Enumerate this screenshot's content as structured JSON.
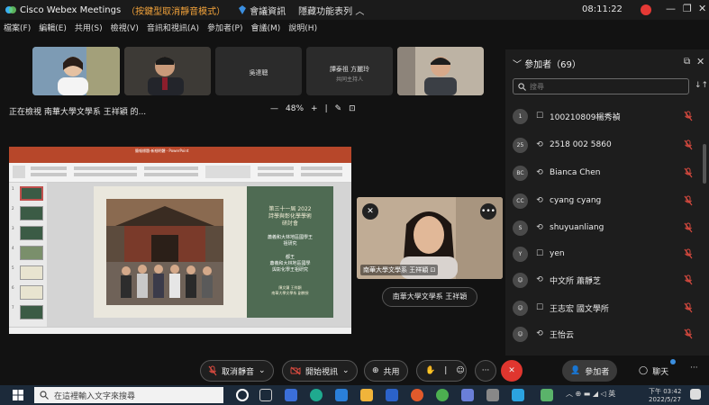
{
  "titlebar": {
    "app": "Cisco Webex Meetings",
    "mode": "（按鍵型取消靜音模式）",
    "meeting_info": "會議資訊",
    "hide_bar": "隱藏功能表列 ︿",
    "clock": "08:11:22"
  },
  "menu": [
    "檔案(F)",
    "編輯(E)",
    "共用(S)",
    "檢視(V)",
    "音訊和視訊(A)",
    "參加者(P)",
    "會議(M)",
    "說明(H)"
  ],
  "thumbnails": [
    {
      "name": ""
    },
    {
      "name": ""
    },
    {
      "name": "吳達聰"
    },
    {
      "name": "譚泰祖 方麗玲",
      "sub": "共同主持人"
    },
    {
      "name": ""
    }
  ],
  "share": {
    "status": "正在檢視 南華大學文學系 王祥穎 的...",
    "zoom": "48%"
  },
  "slide": {
    "panel_lines": [
      "第三十一屆 2022",
      "詩學與彰化學學術",
      "研討會",
      "蕭義和大林地區國學王",
      "祖研究",
      "都王",
      "蕭義和大林地區國學",
      "與彰化學王祖研究",
      "陳文蘭 王祥穎",
      "南華大學文學系 副教授"
    ],
    "title": "簡報標題-新細明體 - PowerPoint"
  },
  "speaker": {
    "label": "南華大學文學系 王祥穎 ⊡",
    "name_pill": "南華大學文學系 王祥穎"
  },
  "participants": {
    "header": "參加者（69）",
    "search_placeholder": "搜尋",
    "list": [
      {
        "avatar": "1",
        "device": "☐",
        "name": "100210809楊秀禎"
      },
      {
        "avatar": "25",
        "device": "⟲",
        "name": "2518 002 5860"
      },
      {
        "avatar": "BC",
        "device": "⟲",
        "name": "Bianca Chen"
      },
      {
        "avatar": "CC",
        "device": "⟲",
        "name": "cyang cyang"
      },
      {
        "avatar": "S",
        "device": "⟲",
        "name": "shuyuanliang"
      },
      {
        "avatar": "Y",
        "device": "☐",
        "name": "yen"
      },
      {
        "avatar": "A",
        "device": "⟲",
        "name": "中文所 蕭靜芝"
      },
      {
        "avatar": "A",
        "device": "☐",
        "name": "王志宏 國文學所"
      },
      {
        "avatar": "A",
        "device": "⟲",
        "name": "王怡云"
      }
    ]
  },
  "controls": {
    "unmute": "取消靜音",
    "start_video": "開始視訊",
    "share": "共用",
    "participants": "參加者",
    "chat": "聊天"
  },
  "taskbar": {
    "search_placeholder": "在這裡輸入文字來搜尋",
    "time": "下午 03:42",
    "date": "2022/5/27"
  },
  "colors": {
    "mute_red": "#d84a3f",
    "accent_orange": "#f3a33b",
    "end_red": "#e0362f",
    "ppt_red": "#b7472a"
  }
}
